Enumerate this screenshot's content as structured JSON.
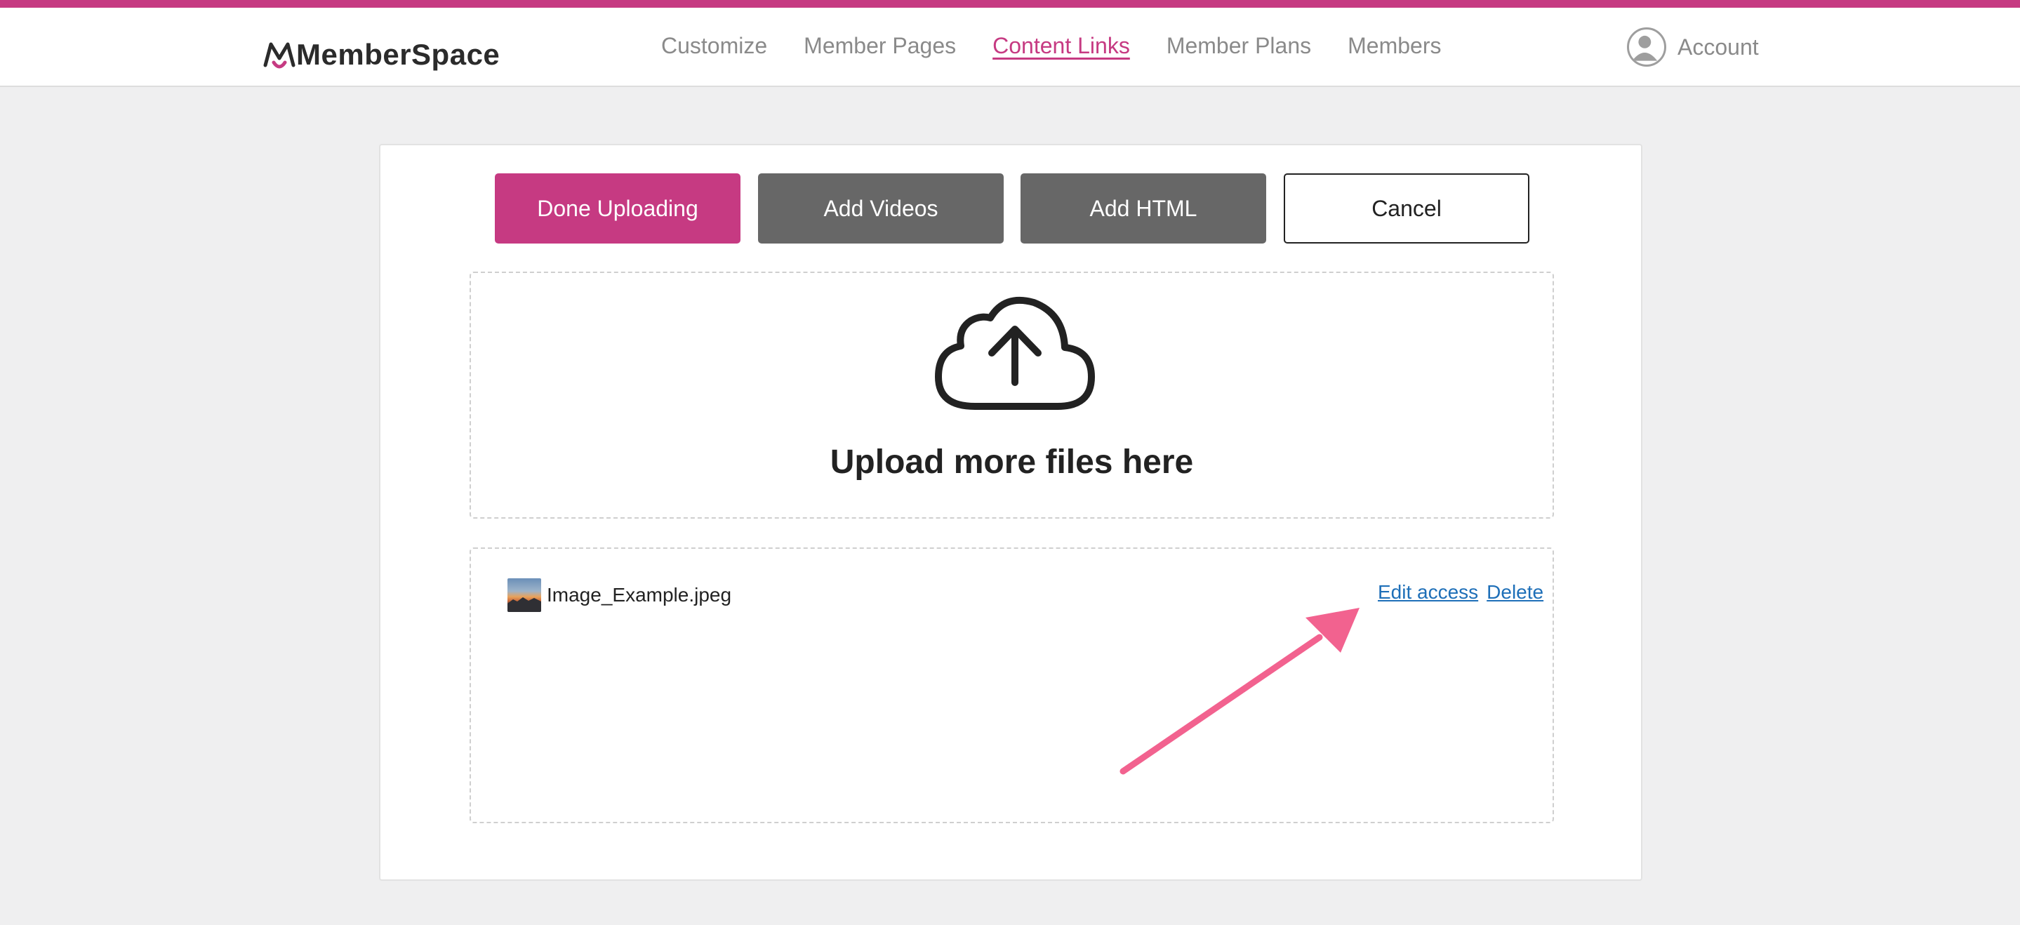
{
  "brand": {
    "name": "MemberSpace",
    "accent": "#c63a82"
  },
  "nav": {
    "items": [
      {
        "label": "Customize"
      },
      {
        "label": "Member Pages"
      },
      {
        "label": "Content Links",
        "active": true
      },
      {
        "label": "Member Plans"
      },
      {
        "label": "Members"
      }
    ],
    "account_label": "Account",
    "account_icon": "user-avatar-icon"
  },
  "toolbar": {
    "done_label": "Done Uploading",
    "videos_label": "Add Videos",
    "html_label": "Add HTML",
    "cancel_label": "Cancel"
  },
  "dropzone": {
    "icon": "cloud-upload-icon",
    "text": "Upload more files here"
  },
  "files": [
    {
      "name": "Image_Example.jpeg",
      "edit_label": "Edit access",
      "delete_label": "Delete"
    }
  ],
  "annotation": {
    "arrow_color": "#f2628f"
  }
}
